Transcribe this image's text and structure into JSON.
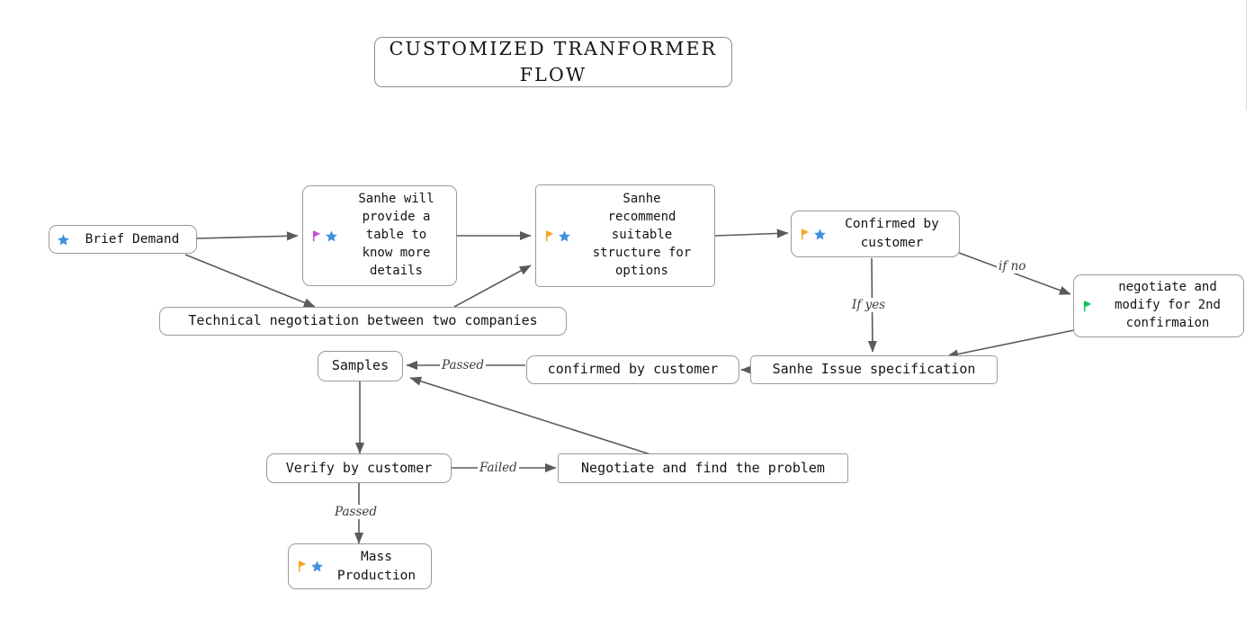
{
  "title": {
    "text": "CUSTOMIZED TRANFORMER FLOW"
  },
  "colors": {
    "node_border": "#9a9a9a",
    "edge": "#5a5a5a",
    "text": "#141414",
    "label_text": "#3a3a3a",
    "flag_orange": "#f5a623",
    "flag_magenta": "#cc4fd0",
    "flag_green": "#12c257",
    "star_blue": "#3d8fe0",
    "background": "#ffffff"
  },
  "nodes": [
    {
      "id": "brief-demand",
      "label": "Brief Demand",
      "icons": [
        "star-blue-icon"
      ]
    },
    {
      "id": "sanhe-table",
      "label": "Sanhe will\nprovide a\ntable to\nknow more\ndetails",
      "icons": [
        "flag-magenta-icon",
        "star-blue-icon"
      ]
    },
    {
      "id": "technical-negotiation",
      "label": "Technical negotiation between two companies",
      "icons": []
    },
    {
      "id": "sanhe-recommend",
      "label": "Sanhe\nrecommend\nsuitable\nstructure for\noptions",
      "icons": [
        "flag-orange-icon",
        "star-blue-icon"
      ]
    },
    {
      "id": "confirmed-by-customer-1",
      "label": "Confirmed by\ncustomer",
      "icons": [
        "flag-orange-icon",
        "star-blue-icon"
      ]
    },
    {
      "id": "negotiate-modify",
      "label": "negotiate and\nmodify for 2nd\nconfirmaion",
      "icons": [
        "flag-green-icon"
      ]
    },
    {
      "id": "sanhe-issue-spec",
      "label": "Sanhe Issue specification",
      "icons": []
    },
    {
      "id": "confirmed-by-customer-2",
      "label": "confirmed by customer",
      "icons": []
    },
    {
      "id": "samples",
      "label": "Samples",
      "icons": []
    },
    {
      "id": "verify-by-customer",
      "label": "Verify by customer",
      "icons": []
    },
    {
      "id": "negotiate-find-problem",
      "label": "Negotiate and find the problem",
      "icons": []
    },
    {
      "id": "mass-production",
      "label": "Mass\nProduction",
      "icons": [
        "flag-orange-icon",
        "star-blue-icon"
      ]
    }
  ],
  "edge_labels": [
    {
      "id": "if-yes",
      "text": "If yes"
    },
    {
      "id": "if-no",
      "text": "if no"
    },
    {
      "id": "passed-1",
      "text": "Passed"
    },
    {
      "id": "failed",
      "text": "Failed"
    },
    {
      "id": "passed-2",
      "text": "Passed"
    }
  ],
  "edges": [
    {
      "from": "brief-demand",
      "to": "sanhe-table"
    },
    {
      "from": "brief-demand",
      "to": "technical-negotiation"
    },
    {
      "from": "sanhe-table",
      "to": "sanhe-recommend"
    },
    {
      "from": "technical-negotiation",
      "to": "sanhe-recommend"
    },
    {
      "from": "sanhe-recommend",
      "to": "confirmed-by-customer-1"
    },
    {
      "from": "confirmed-by-customer-1",
      "to": "sanhe-issue-spec",
      "label": "If yes"
    },
    {
      "from": "confirmed-by-customer-1",
      "to": "negotiate-modify",
      "label": "if no"
    },
    {
      "from": "negotiate-modify",
      "to": "sanhe-issue-spec"
    },
    {
      "from": "sanhe-issue-spec",
      "to": "confirmed-by-customer-2"
    },
    {
      "from": "confirmed-by-customer-2",
      "to": "samples",
      "label": "Passed"
    },
    {
      "from": "samples",
      "to": "verify-by-customer"
    },
    {
      "from": "verify-by-customer",
      "to": "negotiate-find-problem",
      "label": "Failed"
    },
    {
      "from": "negotiate-find-problem",
      "to": "samples"
    },
    {
      "from": "verify-by-customer",
      "to": "mass-production",
      "label": "Passed"
    }
  ]
}
